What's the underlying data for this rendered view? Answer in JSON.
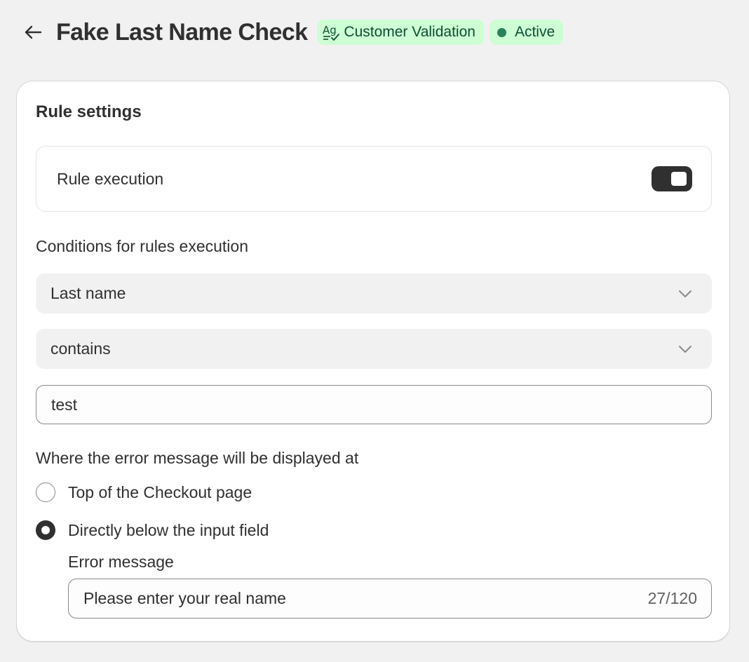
{
  "header": {
    "title": "Fake Last Name Check",
    "badges": [
      {
        "label": "Customer Validation",
        "icon": "text-check-icon"
      },
      {
        "label": "Active",
        "icon": "status-dot"
      }
    ],
    "back_icon": "arrow-left-icon"
  },
  "colors": {
    "badge_bg": "#cdfed4",
    "badge_text": "#0c5132",
    "active_dot": "#29845a",
    "toggle_on": "#303030"
  },
  "rule_settings": {
    "title": "Rule settings",
    "rule_execution": {
      "label": "Rule execution",
      "enabled": true
    },
    "conditions_label": "Conditions for rules execution",
    "field_select": {
      "value": "Last name",
      "icon": "chevron-down-icon"
    },
    "operator_select": {
      "value": "contains",
      "icon": "chevron-down-icon"
    },
    "value_input": {
      "value": "test"
    },
    "display_label": "Where the error message will be displayed at",
    "display_options": [
      {
        "label": "Top of the Checkout page",
        "checked": false
      },
      {
        "label": "Directly below the input field",
        "checked": true
      }
    ],
    "error_message": {
      "label": "Error message",
      "value": "Please enter your real name",
      "counter": "27/120"
    }
  }
}
